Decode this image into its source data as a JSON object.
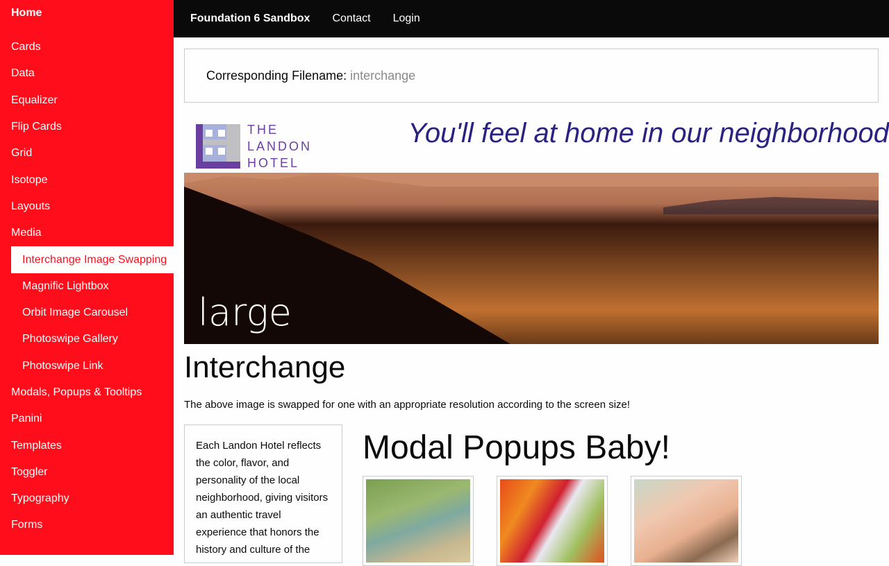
{
  "sidebar": {
    "home": "Home",
    "items": [
      {
        "label": "Cards",
        "level": 0,
        "active": false
      },
      {
        "label": "Data",
        "level": 0,
        "active": false
      },
      {
        "label": "Equalizer",
        "level": 0,
        "active": false
      },
      {
        "label": "Flip Cards",
        "level": 0,
        "active": false
      },
      {
        "label": "Grid",
        "level": 0,
        "active": false
      },
      {
        "label": "Isotope",
        "level": 0,
        "active": false
      },
      {
        "label": "Layouts",
        "level": 0,
        "active": false
      },
      {
        "label": "Media",
        "level": 0,
        "active": false
      },
      {
        "label": "Interchange Image Swapping",
        "level": 1,
        "active": true
      },
      {
        "label": "Magnific Lightbox",
        "level": 1,
        "active": false
      },
      {
        "label": "Orbit Image Carousel",
        "level": 1,
        "active": false
      },
      {
        "label": "Photoswipe Gallery",
        "level": 1,
        "active": false
      },
      {
        "label": "Photoswipe Link",
        "level": 1,
        "active": false
      },
      {
        "label": "Modals, Popups & Tooltips",
        "level": 0,
        "active": false
      },
      {
        "label": "Panini",
        "level": 0,
        "active": false
      },
      {
        "label": "Templates",
        "level": 0,
        "active": false
      },
      {
        "label": "Toggler",
        "level": 0,
        "active": false
      },
      {
        "label": "Typography",
        "level": 0,
        "active": false
      },
      {
        "label": "Forms",
        "level": 0,
        "active": false
      }
    ]
  },
  "topbar": {
    "brand": "Foundation 6 Sandbox",
    "links": [
      "Contact",
      "Login"
    ]
  },
  "filename": {
    "label": "Corresponding Filename:",
    "value": "interchange"
  },
  "hero": {
    "logo_lines": [
      "THE",
      "LANDON",
      "HOTEL"
    ],
    "tagline": "You'll feel at home in our neighborhood",
    "image_label": "large"
  },
  "main": {
    "title": "Interchange",
    "description": "The above image is swapped for one with an appropriate resolution according to the screen size!",
    "card_text": "Each Landon Hotel reflects the color, flavor, and personality of the local neighborhood, giving visitors an authentic travel experience that honors the history and culture of the",
    "modal_title": "Modal Popups Baby!",
    "thumbnails": [
      "man-with-dog-photo",
      "peppers-market-photo",
      "hot-stone-massage-photo"
    ]
  },
  "colors": {
    "sidebar_bg": "#ff0d1b",
    "topbar_bg": "#0a0a0a",
    "tagline": "#2a2280",
    "logo": "#6a3fa0"
  }
}
